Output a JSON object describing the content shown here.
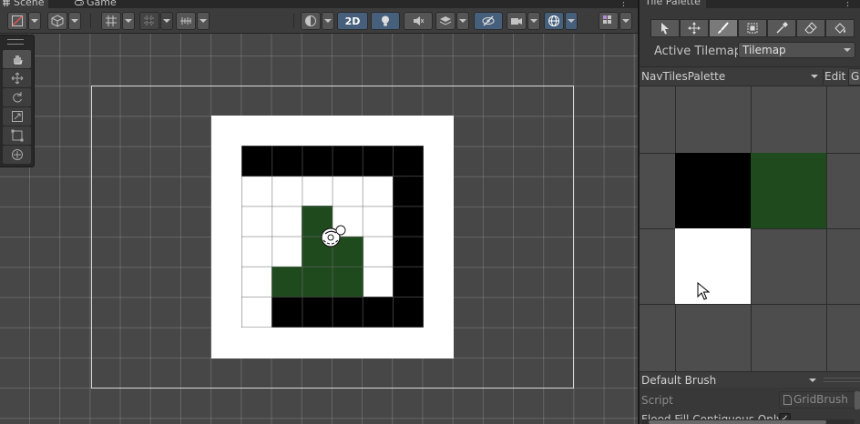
{
  "tabs": {
    "scene": "Scene",
    "game": "Game",
    "more": "⋮"
  },
  "toolbar": {
    "mode_2d": "2D"
  },
  "scene": {
    "tilemap_rows": [
      [
        "black",
        "black",
        "black",
        "black",
        "black",
        "black"
      ],
      [
        "empty",
        "empty",
        "empty",
        "empty",
        "empty",
        "black"
      ],
      [
        "empty",
        "empty",
        "green",
        "empty",
        "empty",
        "black"
      ],
      [
        "empty",
        "empty",
        "green",
        "green",
        "empty",
        "black"
      ],
      [
        "empty",
        "green",
        "green",
        "green",
        "empty",
        "black"
      ],
      [
        "empty",
        "black",
        "black",
        "black",
        "black",
        "black"
      ]
    ],
    "colors": {
      "black": "#000000",
      "green": "#1f4a1e",
      "background": "#ffffff"
    }
  },
  "tile_palette": {
    "tab_title": "Tile Palette",
    "more": "⋮",
    "active_tilemap_label": "Active Tilemap",
    "active_tilemap_value": "Tilemap",
    "palette_name": "NavTilesPalette",
    "edit_label": "Edit",
    "g_label": "G",
    "tiles": [
      {
        "name": "black-tile",
        "color": "#000000"
      },
      {
        "name": "green-tile",
        "color": "#1f4a1e"
      },
      {
        "name": "white-tile",
        "color": "#ffffff"
      }
    ],
    "brush_name": "Default Brush",
    "script_label": "Script",
    "script_value": "GridBrush",
    "flood_fill_label": "Flood Fill Contiguous Only",
    "flood_fill_checked": "✓"
  }
}
